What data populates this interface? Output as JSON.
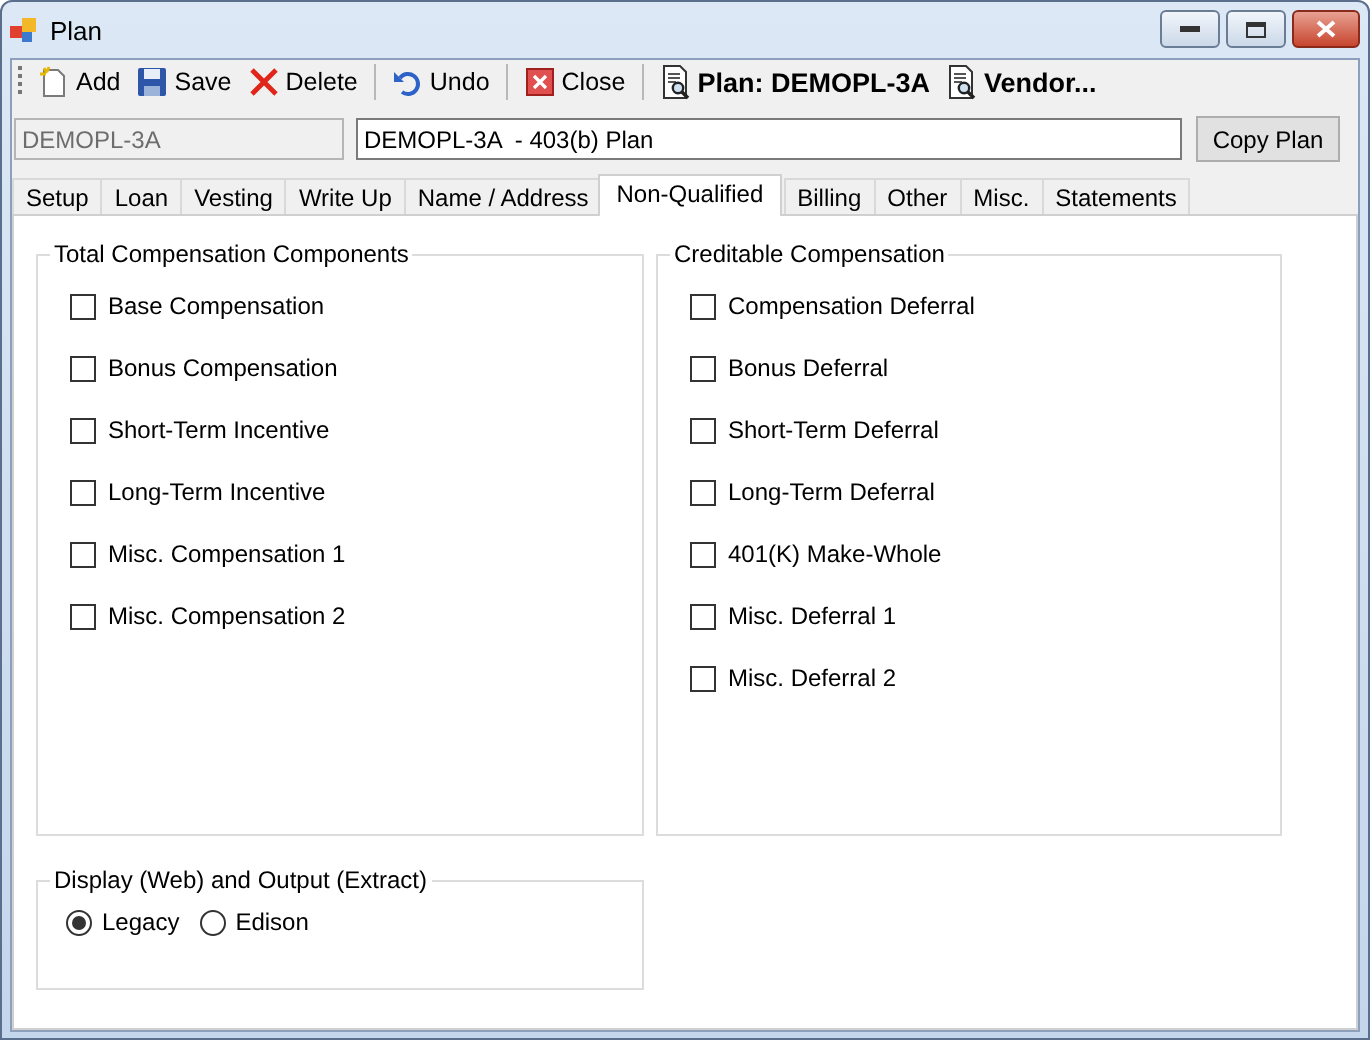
{
  "window": {
    "title": "Plan"
  },
  "toolbar": [
    [
      {
        "label": "Add",
        "kind": "action"
      },
      {
        "label": "Save",
        "kind": "action"
      },
      {
        "label": "Delete",
        "kind": "action"
      }
    ],
    [
      {
        "label": "Undo",
        "kind": "action"
      }
    ],
    [
      {
        "label": "Close",
        "kind": "action"
      }
    ],
    [
      {
        "label": "Plan: DEMOPL-3A",
        "kind": "record"
      },
      {
        "label": "Vendor...",
        "kind": "record"
      }
    ]
  ],
  "plan_code": {
    "value": "DEMOPL-3A",
    "disabled": true
  },
  "plan_name": {
    "value": "DEMOPL-3A  - 403(b) Plan",
    "disabled": false
  },
  "copy_button": "Copy Plan",
  "tabs": [
    {
      "label": "Setup",
      "selected": false
    },
    {
      "label": "Loan",
      "selected": false
    },
    {
      "label": "Vesting",
      "selected": false
    },
    {
      "label": "Write Up",
      "selected": false
    },
    {
      "label": "Name / Address",
      "selected": false
    },
    {
      "label": "Non-Qualified",
      "selected": true
    },
    {
      "label": "Billing",
      "selected": false
    },
    {
      "label": "Other",
      "selected": false
    },
    {
      "label": "Misc.",
      "selected": false
    },
    {
      "label": "Statements",
      "selected": false
    }
  ],
  "total_compensation": {
    "title": "Total Compensation Components",
    "items": [
      {
        "label": "Base Compensation",
        "checked": false
      },
      {
        "label": "Bonus Compensation",
        "checked": false
      },
      {
        "label": "Short-Term Incentive",
        "checked": false
      },
      {
        "label": "Long-Term Incentive",
        "checked": false
      },
      {
        "label": "Misc. Compensation 1",
        "checked": false
      },
      {
        "label": "Misc. Compensation 2",
        "checked": false
      }
    ]
  },
  "creditable_compensation": {
    "title": "Creditable Compensation",
    "items": [
      {
        "label": "Compensation Deferral",
        "checked": false
      },
      {
        "label": "Bonus Deferral",
        "checked": false
      },
      {
        "label": "Short-Term Deferral",
        "checked": false
      },
      {
        "label": "Long-Term Deferral",
        "checked": false
      },
      {
        "label": "401(K) Make-Whole",
        "checked": false
      },
      {
        "label": "Misc. Deferral 1",
        "checked": false
      },
      {
        "label": "Misc. Deferral 2",
        "checked": false
      }
    ]
  },
  "display_output": {
    "title": "Display (Web) and Output (Extract)",
    "options": [
      {
        "label": "Legacy",
        "selected": true
      },
      {
        "label": "Edison",
        "selected": false
      }
    ]
  }
}
